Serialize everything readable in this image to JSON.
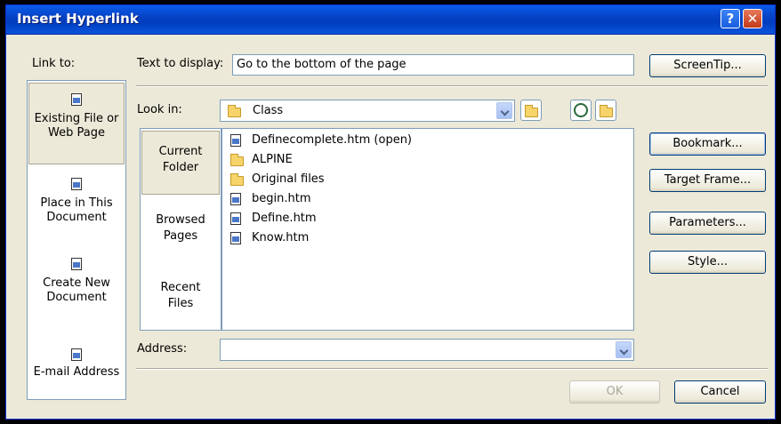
{
  "window": {
    "title": "Insert Hyperlink"
  },
  "titlebar_buttons": {
    "help": "?",
    "close": "✕"
  },
  "link_to": {
    "label": "Link to:",
    "items": [
      {
        "line1": "Existing File or",
        "line2": "Web Page",
        "icon": "page-icon",
        "selected": true
      },
      {
        "line1": "Place in This",
        "line2": "Document",
        "icon": "globe-page-icon",
        "selected": false
      },
      {
        "line1": "Create New",
        "line2": "Document",
        "icon": "new-document-icon",
        "selected": false
      },
      {
        "line1": "E-mail Address",
        "line2": "",
        "icon": "mail-icon",
        "selected": false
      }
    ]
  },
  "text_to_display": {
    "label": "Text to display:",
    "value": "Go to the bottom of the page"
  },
  "look_in": {
    "label": "Look in:",
    "value": "Class"
  },
  "places": [
    {
      "line1": "Current",
      "line2": "Folder",
      "selected": true
    },
    {
      "line1": "Browsed",
      "line2": "Pages",
      "selected": false
    },
    {
      "line1": "Recent",
      "line2": "Files",
      "selected": false
    }
  ],
  "files": [
    {
      "name": "Definecomplete.htm (open)",
      "type": "file"
    },
    {
      "name": "ALPINE",
      "type": "folder"
    },
    {
      "name": "Original files",
      "type": "folder"
    },
    {
      "name": "begin.htm",
      "type": "file"
    },
    {
      "name": "Define.htm",
      "type": "file"
    },
    {
      "name": "Know.htm",
      "type": "file"
    }
  ],
  "address": {
    "label": "Address:",
    "value": ""
  },
  "buttons": {
    "screentip": "ScreenTip...",
    "bookmark": "Bookmark...",
    "target_frame": "Target Frame...",
    "parameters": "Parameters...",
    "style": "Style...",
    "ok": "OK",
    "cancel": "Cancel"
  },
  "colors": {
    "titlebar": "#0a5ce9",
    "dialog_bg": "#ece9d8",
    "border": "#7f9db9"
  }
}
